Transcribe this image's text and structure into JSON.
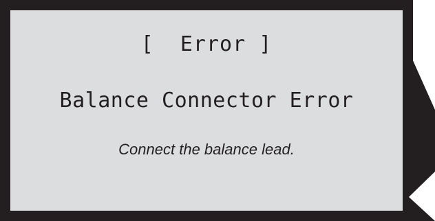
{
  "display": {
    "title": "[  Error ]",
    "message": "Balance Connector Error",
    "hint": "Connect the balance lead."
  },
  "colors": {
    "frame": "#231f20",
    "screen": "#dcdddf",
    "text": "#231f20"
  },
  "icons": {
    "side_tab": "notch-tab",
    "back": "triangle-left-icon"
  }
}
